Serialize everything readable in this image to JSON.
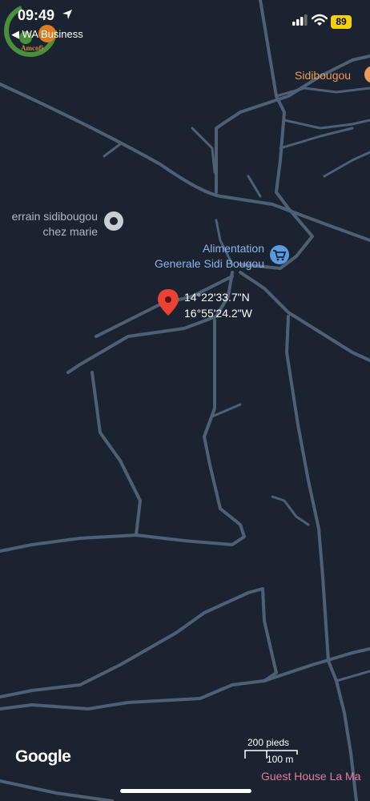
{
  "status_bar": {
    "time": "09:49",
    "back_label": "◀ WA Business",
    "battery": "89",
    "logo_text": "Amcofi"
  },
  "map": {
    "pois": {
      "sidibougou": "Sidibougou",
      "terrain_line1": "errain sidibougou",
      "terrain_line2": "chez marie",
      "alimentation_line1": "Alimentation",
      "alimentation_line2": "Generale Sidi Bougou",
      "guest_house": "Guest House La Ma"
    },
    "dropped_pin": {
      "latitude": "14°22'33.7\"N",
      "longitude": "16°55'24.2\"W"
    }
  },
  "attribution": {
    "brand": "Google"
  },
  "scale": {
    "imperial": "200 pieds",
    "metric": "100 m"
  },
  "colors": {
    "background": "#1b2331",
    "road": "#4f6075",
    "pin": "#ea4335",
    "poi_blue": "#8db4ec",
    "poi_orange": "#ee9b57",
    "poi_pink": "#e57a9f"
  }
}
